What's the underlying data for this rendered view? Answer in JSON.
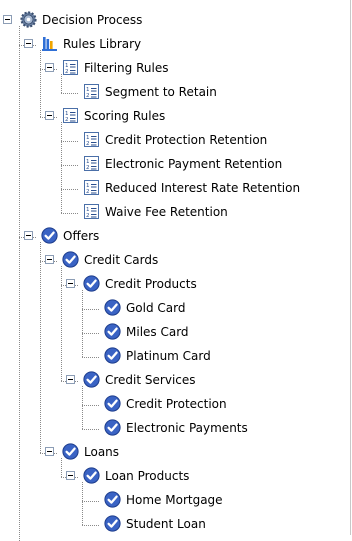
{
  "tree": [
    {
      "label": "Decision Process",
      "icon": "gear-icon",
      "level": 0,
      "expandable": true
    },
    {
      "label": "Rules Library",
      "icon": "rules-library-icon",
      "level": 1,
      "expandable": true
    },
    {
      "label": "Filtering Rules",
      "icon": "rule-list-icon",
      "level": 2,
      "expandable": true
    },
    {
      "label": "Segment to Retain",
      "icon": "rule-list-icon",
      "level": 3,
      "expandable": false
    },
    {
      "label": "Scoring Rules",
      "icon": "rule-list-icon",
      "level": 2,
      "expandable": true
    },
    {
      "label": "Credit Protection Retention",
      "icon": "rule-list-icon",
      "level": 3,
      "expandable": false
    },
    {
      "label": "Electronic Payment Retention",
      "icon": "rule-list-icon",
      "level": 3,
      "expandable": false
    },
    {
      "label": "Reduced Interest Rate Retention",
      "icon": "rule-list-icon",
      "level": 3,
      "expandable": false
    },
    {
      "label": "Waive Fee Retention",
      "icon": "rule-list-icon",
      "level": 3,
      "expandable": false
    },
    {
      "label": "Offers",
      "icon": "offer-check-icon",
      "level": 1,
      "expandable": true
    },
    {
      "label": "Credit Cards",
      "icon": "offer-check-icon",
      "level": 2,
      "expandable": true
    },
    {
      "label": "Credit Products",
      "icon": "offer-check-icon",
      "level": 3,
      "expandable": true
    },
    {
      "label": "Gold Card",
      "icon": "offer-check-icon",
      "level": 4,
      "expandable": false
    },
    {
      "label": "Miles Card",
      "icon": "offer-check-icon",
      "level": 4,
      "expandable": false
    },
    {
      "label": "Platinum Card",
      "icon": "offer-check-icon",
      "level": 4,
      "expandable": false
    },
    {
      "label": "Credit Services",
      "icon": "offer-check-icon",
      "level": 3,
      "expandable": true
    },
    {
      "label": "Credit Protection",
      "icon": "offer-check-icon",
      "level": 4,
      "expandable": false
    },
    {
      "label": "Electronic Payments",
      "icon": "offer-check-icon",
      "level": 4,
      "expandable": false
    },
    {
      "label": "Loans",
      "icon": "offer-check-icon",
      "level": 2,
      "expandable": true
    },
    {
      "label": "Loan Products",
      "icon": "offer-check-icon",
      "level": 3,
      "expandable": true
    },
    {
      "label": "Home Mortgage",
      "icon": "offer-check-icon",
      "level": 4,
      "expandable": false
    },
    {
      "label": "Student Loan",
      "icon": "offer-check-icon",
      "level": 4,
      "expandable": false
    }
  ],
  "colors": {
    "connector": "#8a8a8a",
    "offer_icon": "#3a63c4",
    "toggle_border": "#8c9db5"
  }
}
